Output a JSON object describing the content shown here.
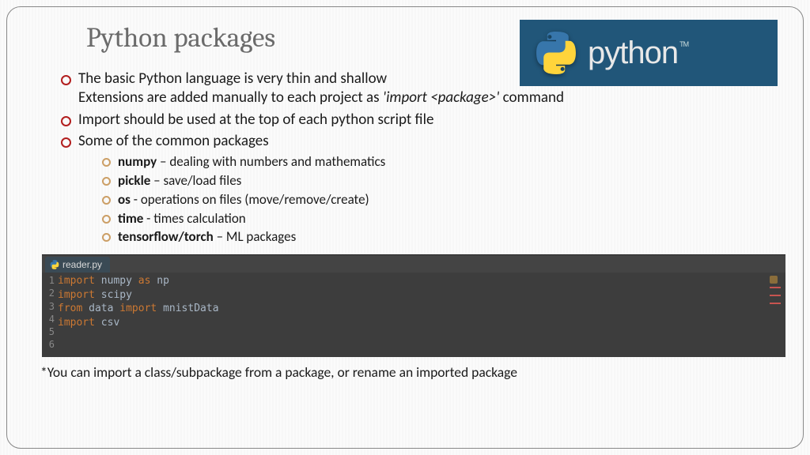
{
  "title": "Python packages",
  "logo": {
    "wordmark": "python",
    "tm": "TM",
    "icon_name": "python-logo-icon"
  },
  "bullets": {
    "b1_line1": "The basic Python language is very thin and shallow",
    "b1_line2_a": "Extensions are added manually to each project as ",
    "b1_line2_italic": "'import <package>'",
    "b1_line2_c": " command",
    "b2": "Import should be used at the top of each python script file",
    "b3": "Some of the common packages"
  },
  "packages": [
    {
      "name": "numpy",
      "sep": " – ",
      "desc": "dealing with numbers and mathematics"
    },
    {
      "name": "pickle",
      "sep": " – ",
      "desc": "save/load files"
    },
    {
      "name": "os",
      "sep": "  - ",
      "desc": "operations on files (move/remove/create)"
    },
    {
      "name": "time",
      "sep": "  - ",
      "desc": "times calculation"
    },
    {
      "name": "tensorflow/torch",
      "sep": " – ",
      "desc": "ML packages"
    }
  ],
  "code": {
    "tab_filename": "reader.py",
    "line_numbers": [
      "1",
      "2",
      "3",
      "4",
      "5",
      "6"
    ],
    "lines": {
      "l1": {
        "kw1": "import",
        "a": " numpy ",
        "kw2": "as",
        "b": " np"
      },
      "l2": {
        "kw1": "import",
        "a": " scipy"
      },
      "l3": {
        "kw1": "from",
        "a": " data ",
        "kw2": "import",
        "b": " mnistData"
      },
      "l4": {
        "kw1": "import",
        "a": " csv"
      }
    }
  },
  "footnote": "*You can import a class/subpackage from a package, or rename an imported package"
}
